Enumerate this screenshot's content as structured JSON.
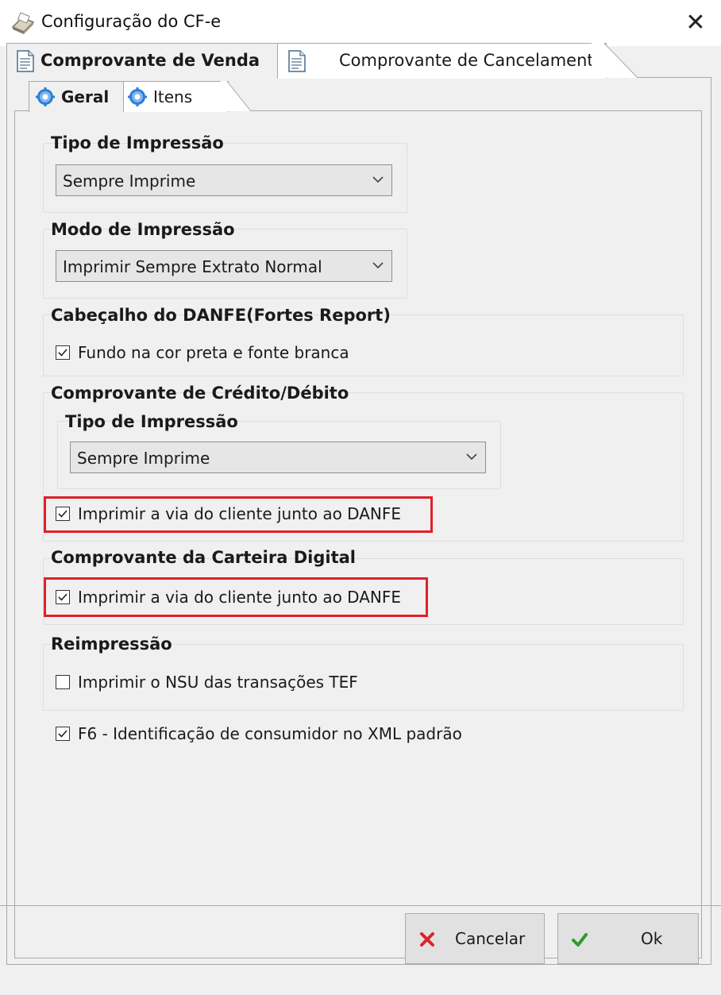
{
  "window": {
    "title": "Configuração do CF-e",
    "app_icon": "printer-icon",
    "close_icon": "close-icon",
    "close_glyph": "✕"
  },
  "tabs": [
    {
      "label": "Comprovante de Venda",
      "icon": "document-icon",
      "active": true
    },
    {
      "label": "Comprovante de Cancelamento",
      "icon": "document-icon",
      "active": false
    }
  ],
  "subtabs": [
    {
      "label": "Geral",
      "icon": "gear-icon",
      "active": true
    },
    {
      "label": "Itens",
      "icon": "gear-icon",
      "active": false
    }
  ],
  "tipo_impressao": {
    "title": "Tipo de Impressão",
    "selected": "Sempre Imprime"
  },
  "modo_impressao": {
    "title": "Modo de Impressão",
    "selected": "Imprimir Sempre Extrato Normal"
  },
  "cabecalho": {
    "title": "Cabeçalho do DANFE(Fortes Report)",
    "checkbox": {
      "label": "Fundo na cor preta e fonte branca",
      "checked": true
    }
  },
  "credito_debito": {
    "title": "Comprovante de Crédito/Débito",
    "tipo_title": "Tipo de Impressão",
    "selected": "Sempre Imprime",
    "checkbox": {
      "label": "Imprimir a via do cliente junto ao DANFE",
      "checked": true,
      "highlighted": true
    }
  },
  "carteira_digital": {
    "title": "Comprovante da Carteira Digital",
    "checkbox": {
      "label": "Imprimir a via do cliente junto ao DANFE",
      "checked": true,
      "highlighted": true
    }
  },
  "reimpressao": {
    "title": "Reimpressão",
    "checkbox": {
      "label": "Imprimir o NSU das transações TEF",
      "checked": false
    }
  },
  "f6_checkbox": {
    "label": "F6 - Identificação de consumidor no XML padrão",
    "checked": true
  },
  "buttons": {
    "cancel": {
      "label": "Cancelar",
      "icon": "x-icon"
    },
    "ok": {
      "label": "Ok",
      "icon": "checkmark-icon"
    }
  },
  "colors": {
    "highlight": "#e0202a",
    "cancel_icon": "#d7262c",
    "ok_icon": "#2e9b2e",
    "gear": "#2b7fd4"
  }
}
